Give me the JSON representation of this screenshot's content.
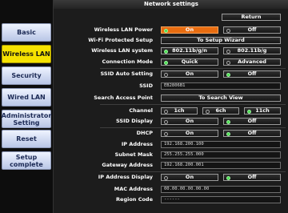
{
  "title": "Network settings",
  "return_label": "Return",
  "sidebar": [
    {
      "label": "Basic"
    },
    {
      "label": "Wireless LAN",
      "active": true
    },
    {
      "label": "Security"
    },
    {
      "label": "Wired LAN"
    },
    {
      "label": "Administrator Setting"
    },
    {
      "label": "Reset"
    },
    {
      "label": "Setup complete"
    }
  ],
  "rows": {
    "wireless_power": {
      "label": "Wireless LAN Power",
      "on": "On",
      "off": "Off",
      "selected": "On"
    },
    "wps": {
      "label": "Wi-Fi Protected Setup",
      "button": "To Setup Wizard"
    },
    "system": {
      "label": "Wireless LAN system",
      "opt1": "802.11b/g/n",
      "opt2": "802.11b/g",
      "selected": "802.11b/g/n"
    },
    "mode": {
      "label": "Connection Mode",
      "opt1": "Quick",
      "opt2": "Advanced",
      "selected": "Quick"
    },
    "ssid_auto": {
      "label": "SSID Auto Setting",
      "on": "On",
      "off": "Off",
      "selected": "Off"
    },
    "ssid": {
      "label": "SSID",
      "value": "EB2806B1"
    },
    "search": {
      "label": "Search Access Point",
      "button": "To Search View"
    },
    "channel": {
      "label": "Channel",
      "opt1": "1ch",
      "opt2": "6ch",
      "opt3": "11ch",
      "selected": "11ch"
    },
    "ssid_display": {
      "label": "SSID Display",
      "on": "On",
      "off": "Off",
      "selected": "Off"
    },
    "dhcp": {
      "label": "DHCP",
      "on": "On",
      "off": "Off",
      "selected": "Off"
    },
    "ip": {
      "label": "IP Address",
      "value": "192.168.200.100"
    },
    "mask": {
      "label": "Subnet Mask",
      "value": "255.255.255.000"
    },
    "gateway": {
      "label": "Gateway Address",
      "value": "192.168.200.001"
    },
    "ip_display": {
      "label": "IP Address Display",
      "on": "On",
      "off": "Off",
      "selected": "Off"
    },
    "mac": {
      "label": "MAC Address",
      "value": "00.00.00.00.00.00"
    },
    "region": {
      "label": "Region Code",
      "value": "------"
    }
  },
  "colors": {
    "active_tab": "#f6e200",
    "selected_option": "#e86c10",
    "radio_on": "#4de052"
  }
}
